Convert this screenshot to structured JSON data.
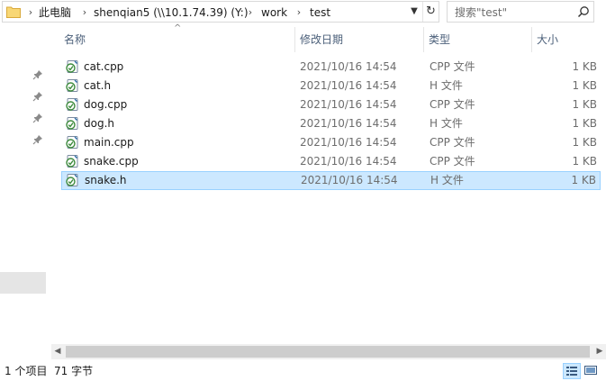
{
  "address_bar": {
    "crumbs": [
      "此电脑",
      "shenqian5 (\\\\10.1.74.39) (Y:)",
      "work",
      "test"
    ]
  },
  "search": {
    "placeholder": "搜索\"test\""
  },
  "columns": {
    "name": "名称",
    "date": "修改日期",
    "type": "类型",
    "size": "大小"
  },
  "files": [
    {
      "name": "cat.cpp",
      "date": "2021/10/16 14:54",
      "type": "CPP 文件",
      "size": "1 KB"
    },
    {
      "name": "cat.h",
      "date": "2021/10/16 14:54",
      "type": "H 文件",
      "size": "1 KB"
    },
    {
      "name": "dog.cpp",
      "date": "2021/10/16 14:54",
      "type": "CPP 文件",
      "size": "1 KB"
    },
    {
      "name": "dog.h",
      "date": "2021/10/16 14:54",
      "type": "H 文件",
      "size": "1 KB"
    },
    {
      "name": "main.cpp",
      "date": "2021/10/16 14:54",
      "type": "CPP 文件",
      "size": "1 KB"
    },
    {
      "name": "snake.cpp",
      "date": "2021/10/16 14:54",
      "type": "CPP 文件",
      "size": "1 KB"
    },
    {
      "name": "snake.h",
      "date": "2021/10/16 14:54",
      "type": "H 文件",
      "size": "1 KB"
    }
  ],
  "selected_file": "snake.h",
  "status": {
    "item_count": "1 个项目",
    "size": "71 字节"
  },
  "colors": {
    "selection_bg": "#cce8ff",
    "selection_border": "#99d1ff",
    "header_text": "#4c607a"
  }
}
